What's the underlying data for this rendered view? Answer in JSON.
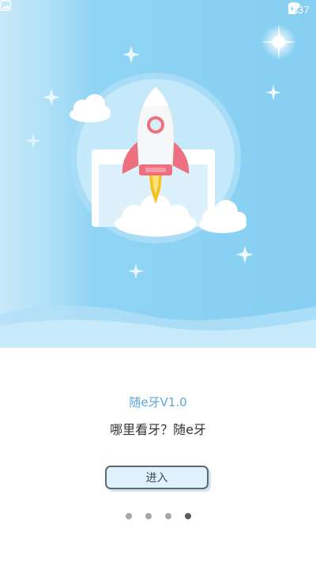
{
  "status_bar": {
    "time": "2:37",
    "icons": [
      "image-notification-icon",
      "wifi-icon",
      "no-signal-icon",
      "battery-charging-icon"
    ]
  },
  "hero": {
    "illustration": "rocket-launch-illustration",
    "colors": {
      "sky": "#8fd4f4",
      "circle": "#bfe8fb",
      "rocket_body": "#f4f6f8",
      "rocket_accent": "#ee6f7f",
      "flame": "#f6c21f"
    }
  },
  "app": {
    "version_title": "随e牙V1.0",
    "slogan": "哪里看牙？随e牙"
  },
  "actions": {
    "enter_label": "进入"
  },
  "pagination": {
    "total": 4,
    "current": 4
  }
}
